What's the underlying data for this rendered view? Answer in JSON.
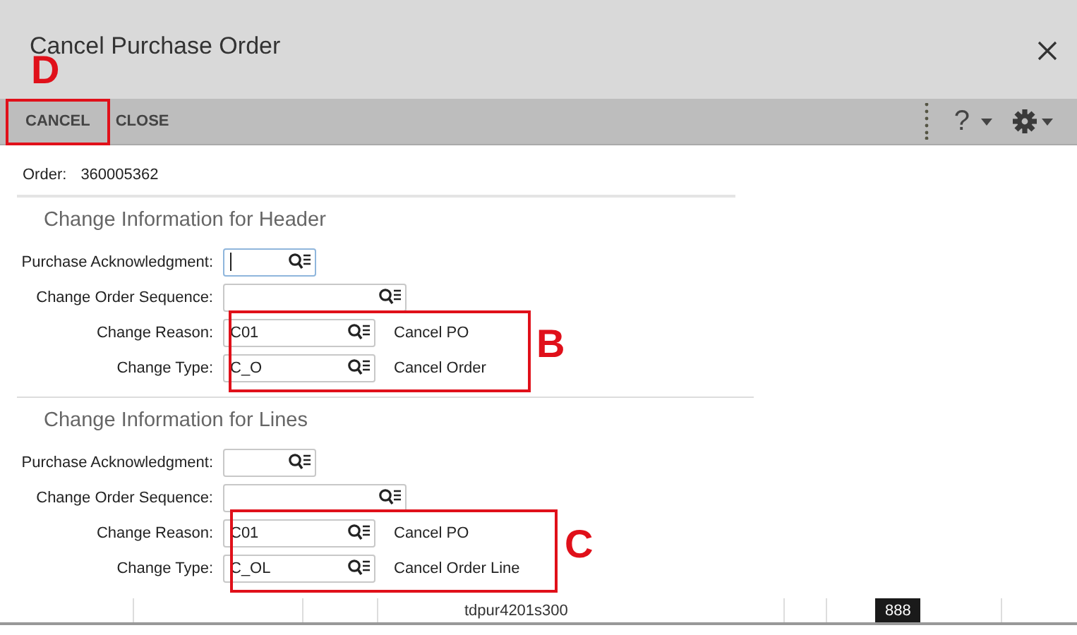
{
  "window": {
    "title": "Cancel Purchase Order"
  },
  "toolbar": {
    "buttons": [
      {
        "label": "CANCEL"
      },
      {
        "label": "CLOSE"
      }
    ],
    "help": "?"
  },
  "order": {
    "label": "Order:",
    "value": "360005362"
  },
  "sections": [
    {
      "title": "Change Information for Header",
      "fields": [
        {
          "label": "Purchase Acknowledgment:",
          "focused": true
        },
        {
          "label": "Change Order Sequence:",
          "focused": false
        },
        {
          "label": "Change Reason:",
          "value": "C01",
          "focused": false,
          "description": "Cancel PO"
        },
        {
          "label": "Change Type:",
          "value": "C_O",
          "focused": false,
          "description": "Cancel Order"
        }
      ]
    },
    {
      "title": "Change Information for Lines",
      "fields": [
        {
          "label": "Purchase Acknowledgment:",
          "focused": false
        },
        {
          "label": "Change Order Sequence:",
          "focused": false
        },
        {
          "label": "Change Reason:",
          "value": "C01",
          "focused": false,
          "description": "Cancel PO"
        },
        {
          "label": "Change Type:",
          "value": "C_OL",
          "focused": false,
          "description": "Cancel Order Line"
        }
      ]
    }
  ],
  "status_bar": {
    "session": "tdpur4201s300",
    "badge": "888"
  },
  "annotations": [
    "D",
    "B",
    "C"
  ]
}
